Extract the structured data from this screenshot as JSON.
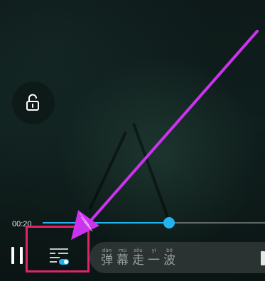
{
  "player": {
    "current_time": "00:20",
    "progress_fraction": 0.57
  },
  "controls": {
    "lock_icon": "unlock-icon",
    "pause_icon": "pause-icon",
    "danmaku_toggle_icon": "danmaku-settings-toggle-icon"
  },
  "danmaku_input": {
    "placeholder_chars": [
      {
        "pinyin": "dàn",
        "char": "弹"
      },
      {
        "pinyin": "mù",
        "char": "幕"
      },
      {
        "pinyin": "zǒu",
        "char": "走"
      },
      {
        "pinyin": "yí",
        "char": "一"
      },
      {
        "pinyin": "bō",
        "char": "波"
      }
    ]
  },
  "colors": {
    "accent": "#22b4f0",
    "highlight": "#e0246c",
    "annotation_arrow": "#cc33ee"
  }
}
